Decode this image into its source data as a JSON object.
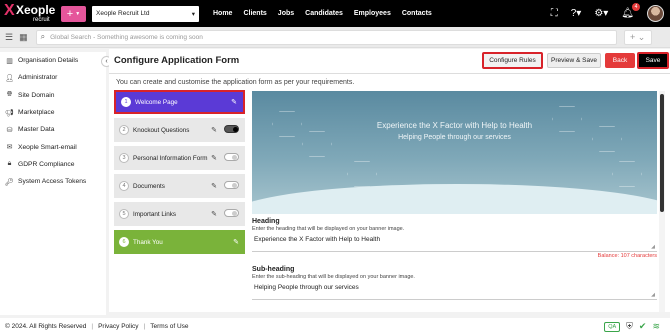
{
  "app": {
    "logo_text": "Xeople",
    "logo_sub": "recruit",
    "company": "Xeople Recruit Ltd",
    "nav": [
      "Home",
      "Clients",
      "Jobs",
      "Candidates",
      "Employees",
      "Contacts"
    ],
    "notifications_count": "4"
  },
  "search": {
    "placeholder": "Global Search - Something awesome is coming soon",
    "add_label": "+ ⌄"
  },
  "sidebar": {
    "items": [
      {
        "label": "Organisation Details",
        "icon": "building-icon"
      },
      {
        "label": "Administrator",
        "icon": "person-icon"
      },
      {
        "label": "Site Domain",
        "icon": "globe-icon"
      },
      {
        "label": "Marketplace",
        "icon": "megaphone-icon"
      },
      {
        "label": "Master Data",
        "icon": "database-icon"
      },
      {
        "label": "Xeople Smart-email",
        "icon": "envelope-icon"
      },
      {
        "label": "GDPR Compliance",
        "icon": "lock-icon"
      },
      {
        "label": "System Access Tokens",
        "icon": "key-icon"
      }
    ]
  },
  "main": {
    "title": "Configure Application Form",
    "subtitle": "You can create and customise the application form as per your requirements.",
    "buttons": {
      "configure": "Configure Rules",
      "preview": "Preview & Save",
      "back": "Back",
      "save": "Save"
    },
    "steps": [
      {
        "num": "1",
        "label": "Welcome Page",
        "state": "active"
      },
      {
        "num": "2",
        "label": "Knockout Questions",
        "state": "toggle-on"
      },
      {
        "num": "3",
        "label": "Personal Information Form",
        "state": "toggle-off"
      },
      {
        "num": "4",
        "label": "Documents",
        "state": "toggle-off"
      },
      {
        "num": "5",
        "label": "Important Links",
        "state": "toggle-off"
      },
      {
        "num": "6",
        "label": "Thank You",
        "state": "done"
      }
    ],
    "banner": {
      "heading": "Experience the X Factor with Help to Health",
      "subheading": "Helping People through our services"
    },
    "fields": {
      "heading_label": "Heading",
      "heading_desc": "Enter the heading that will be displayed on your banner image.",
      "heading_value": "Experience the X Factor with Help to Health",
      "heading_balance": "Balance: 107 characters",
      "sub_label": "Sub-heading",
      "sub_desc": "Enter the sub-heading that will be displayed on your banner image.",
      "sub_value": "Helping People through our services"
    }
  },
  "footer": {
    "copyright": "© 2024. All Rights Reserved",
    "privacy": "Privacy Policy",
    "terms": "Terms of Use",
    "qa": "QA"
  },
  "colors": {
    "accent_purple": "#5b3ad6",
    "accent_green": "#7ab33a",
    "back_red": "#e43a3a",
    "highlight_red": "#d8232a",
    "brand_pink": "#e5569b"
  }
}
